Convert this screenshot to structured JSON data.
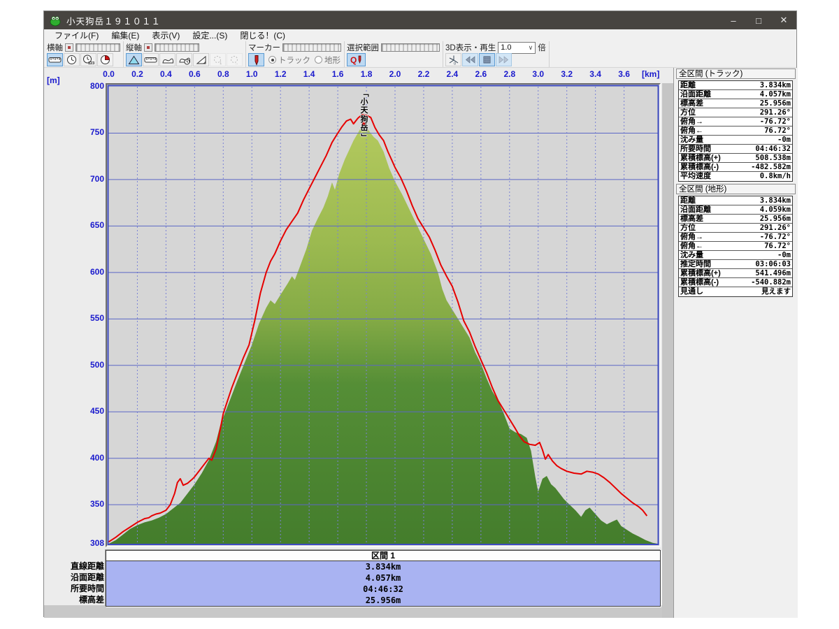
{
  "window": {
    "title": "小天狗岳１９１０１１",
    "controls": {
      "minimize": "–",
      "maximize": "□",
      "close": "✕"
    }
  },
  "menu": {
    "items": [
      {
        "label": "ファイル(F)"
      },
      {
        "label": "編集(E)"
      },
      {
        "label": "表示(V)"
      },
      {
        "label": "設定...(S)"
      },
      {
        "label": "閉じる！(C)"
      }
    ]
  },
  "toolbar": {
    "xaxis_label": "横軸",
    "yaxis_label": "縦軸",
    "marker_label": "マーカー",
    "selection_label": "選択範囲",
    "playback_label": "3D表示・再生",
    "playback_rate": "1.0",
    "playback_rate_suffix": "倍",
    "radio_track": "トラック",
    "radio_terrain": "地形"
  },
  "axis": {
    "y_unit": "[m]",
    "x_unit": "[km]"
  },
  "chart_data": {
    "type": "area",
    "title": "標高プロファイル (elevation profile)",
    "xlabel": "[km]",
    "ylabel": "[m]",
    "x_range": [
      0,
      3.834
    ],
    "y_range": [
      308,
      800
    ],
    "x_ticks": [
      0.0,
      0.2,
      0.4,
      0.6,
      0.8,
      1.0,
      1.2,
      1.4,
      1.6,
      1.8,
      2.0,
      2.2,
      2.4,
      2.6,
      2.8,
      3.0,
      3.2,
      3.4,
      3.6
    ],
    "y_ticks": [
      800,
      750,
      700,
      650,
      600,
      550,
      500,
      450,
      400,
      350,
      308
    ],
    "grid": true,
    "colors": {
      "plot_bg": "#d6d6d6",
      "grid_h": "#5b67c6",
      "grid_v": "#7a82d6",
      "frame": "#3c49c0",
      "tick_text": "#1a1acd",
      "track_line": "#e60000",
      "terrain_top": "#b3c95e",
      "terrain_mid": "#9cba50",
      "terrain_low": "#558e36",
      "terrain_bottom": "#447d2c"
    },
    "peak_annotation": {
      "text": "「小天狗岳」",
      "x_km": 1.785
    },
    "series": [
      {
        "name": "地形",
        "type": "area",
        "points": [
          [
            0,
            308
          ],
          [
            0.05,
            312
          ],
          [
            0.1,
            318
          ],
          [
            0.15,
            324
          ],
          [
            0.2,
            328
          ],
          [
            0.25,
            331
          ],
          [
            0.3,
            333
          ],
          [
            0.35,
            336
          ],
          [
            0.4,
            340
          ],
          [
            0.45,
            346
          ],
          [
            0.5,
            352
          ],
          [
            0.55,
            362
          ],
          [
            0.6,
            372
          ],
          [
            0.65,
            384
          ],
          [
            0.7,
            398
          ],
          [
            0.75,
            418
          ],
          [
            0.78,
            436
          ],
          [
            0.82,
            452
          ],
          [
            0.86,
            468
          ],
          [
            0.9,
            484
          ],
          [
            0.95,
            503
          ],
          [
            1.0,
            522
          ],
          [
            1.05,
            545
          ],
          [
            1.1,
            562
          ],
          [
            1.13,
            570
          ],
          [
            1.16,
            566
          ],
          [
            1.2,
            576
          ],
          [
            1.25,
            588
          ],
          [
            1.28,
            596
          ],
          [
            1.3,
            592
          ],
          [
            1.33,
            604
          ],
          [
            1.38,
            625
          ],
          [
            1.42,
            645
          ],
          [
            1.46,
            658
          ],
          [
            1.5,
            670
          ],
          [
            1.53,
            682
          ],
          [
            1.56,
            697
          ],
          [
            1.58,
            689
          ],
          [
            1.61,
            706
          ],
          [
            1.65,
            722
          ],
          [
            1.68,
            732
          ],
          [
            1.71,
            742
          ],
          [
            1.74,
            750
          ],
          [
            1.77,
            758
          ],
          [
            1.79,
            760
          ],
          [
            1.82,
            752
          ],
          [
            1.85,
            746
          ],
          [
            1.88,
            742
          ],
          [
            1.92,
            730
          ],
          [
            1.96,
            712
          ],
          [
            2.0,
            698
          ],
          [
            2.05,
            684
          ],
          [
            2.1,
            668
          ],
          [
            2.15,
            652
          ],
          [
            2.2,
            636
          ],
          [
            2.25,
            620
          ],
          [
            2.3,
            600
          ],
          [
            2.33,
            582
          ],
          [
            2.36,
            570
          ],
          [
            2.4,
            560
          ],
          [
            2.44,
            550
          ],
          [
            2.48,
            540
          ],
          [
            2.52,
            530
          ],
          [
            2.56,
            514
          ],
          [
            2.6,
            502
          ],
          [
            2.64,
            486
          ],
          [
            2.68,
            472
          ],
          [
            2.72,
            462
          ],
          [
            2.76,
            448
          ],
          [
            2.8,
            432
          ],
          [
            2.84,
            428
          ],
          [
            2.88,
            426
          ],
          [
            2.92,
            422
          ],
          [
            2.95,
            408
          ],
          [
            2.98,
            380
          ],
          [
            3.0,
            364
          ],
          [
            3.03,
            378
          ],
          [
            3.06,
            381
          ],
          [
            3.09,
            372
          ],
          [
            3.12,
            368
          ],
          [
            3.15,
            362
          ],
          [
            3.18,
            356
          ],
          [
            3.22,
            350
          ],
          [
            3.26,
            344
          ],
          [
            3.3,
            337
          ],
          [
            3.33,
            344
          ],
          [
            3.36,
            347
          ],
          [
            3.4,
            340
          ],
          [
            3.44,
            333
          ],
          [
            3.48,
            329
          ],
          [
            3.52,
            332
          ],
          [
            3.55,
            334
          ],
          [
            3.58,
            327
          ],
          [
            3.62,
            323
          ],
          [
            3.66,
            319
          ],
          [
            3.7,
            316
          ],
          [
            3.75,
            312
          ],
          [
            3.8,
            309
          ],
          [
            3.834,
            308
          ]
        ]
      },
      {
        "name": "トラック",
        "type": "line",
        "points": [
          [
            0,
            310
          ],
          [
            0.05,
            315
          ],
          [
            0.1,
            321
          ],
          [
            0.15,
            326
          ],
          [
            0.2,
            331
          ],
          [
            0.25,
            335
          ],
          [
            0.28,
            336
          ],
          [
            0.3,
            338
          ],
          [
            0.33,
            340
          ],
          [
            0.36,
            341
          ],
          [
            0.4,
            344
          ],
          [
            0.43,
            350
          ],
          [
            0.46,
            362
          ],
          [
            0.48,
            374
          ],
          [
            0.5,
            378
          ],
          [
            0.52,
            371
          ],
          [
            0.55,
            373
          ],
          [
            0.58,
            377
          ],
          [
            0.6,
            380
          ],
          [
            0.63,
            386
          ],
          [
            0.66,
            392
          ],
          [
            0.7,
            400
          ],
          [
            0.72,
            398
          ],
          [
            0.75,
            410
          ],
          [
            0.78,
            432
          ],
          [
            0.8,
            448
          ],
          [
            0.83,
            462
          ],
          [
            0.86,
            476
          ],
          [
            0.9,
            492
          ],
          [
            0.94,
            508
          ],
          [
            0.98,
            522
          ],
          [
            1.02,
            548
          ],
          [
            1.06,
            578
          ],
          [
            1.1,
            600
          ],
          [
            1.13,
            612
          ],
          [
            1.16,
            620
          ],
          [
            1.2,
            634
          ],
          [
            1.24,
            646
          ],
          [
            1.28,
            655
          ],
          [
            1.32,
            664
          ],
          [
            1.36,
            678
          ],
          [
            1.4,
            690
          ],
          [
            1.44,
            702
          ],
          [
            1.48,
            714
          ],
          [
            1.52,
            726
          ],
          [
            1.56,
            740
          ],
          [
            1.6,
            750
          ],
          [
            1.63,
            757
          ],
          [
            1.66,
            763
          ],
          [
            1.69,
            765
          ],
          [
            1.71,
            760
          ],
          [
            1.74,
            766
          ],
          [
            1.77,
            770
          ],
          [
            1.8,
            769
          ],
          [
            1.83,
            767
          ],
          [
            1.86,
            756
          ],
          [
            1.89,
            748
          ],
          [
            1.92,
            742
          ],
          [
            1.95,
            730
          ],
          [
            1.98,
            720
          ],
          [
            2.0,
            713
          ],
          [
            2.04,
            702
          ],
          [
            2.08,
            688
          ],
          [
            2.12,
            672
          ],
          [
            2.16,
            658
          ],
          [
            2.2,
            648
          ],
          [
            2.24,
            638
          ],
          [
            2.28,
            624
          ],
          [
            2.32,
            608
          ],
          [
            2.36,
            596
          ],
          [
            2.4,
            585
          ],
          [
            2.44,
            568
          ],
          [
            2.48,
            548
          ],
          [
            2.52,
            536
          ],
          [
            2.56,
            520
          ],
          [
            2.6,
            506
          ],
          [
            2.64,
            492
          ],
          [
            2.68,
            476
          ],
          [
            2.72,
            462
          ],
          [
            2.76,
            452
          ],
          [
            2.8,
            442
          ],
          [
            2.84,
            432
          ],
          [
            2.87,
            424
          ],
          [
            2.9,
            418
          ],
          [
            2.94,
            415
          ],
          [
            2.98,
            414
          ],
          [
            3.01,
            417
          ],
          [
            3.03,
            409
          ],
          [
            3.05,
            399
          ],
          [
            3.07,
            404
          ],
          [
            3.1,
            397
          ],
          [
            3.13,
            392
          ],
          [
            3.16,
            389
          ],
          [
            3.2,
            386
          ],
          [
            3.25,
            384
          ],
          [
            3.3,
            383
          ],
          [
            3.34,
            386
          ],
          [
            3.38,
            385
          ],
          [
            3.42,
            383
          ],
          [
            3.46,
            379
          ],
          [
            3.5,
            374
          ],
          [
            3.54,
            368
          ],
          [
            3.58,
            362
          ],
          [
            3.62,
            357
          ],
          [
            3.66,
            352
          ],
          [
            3.7,
            348
          ],
          [
            3.73,
            344
          ],
          [
            3.76,
            338
          ]
        ]
      }
    ]
  },
  "track_panel": {
    "title": "全区間 (トラック)",
    "rows": [
      {
        "label": "距離",
        "value": "3.834km"
      },
      {
        "label": "沿面距離",
        "value": "4.057km"
      },
      {
        "label": "標高差",
        "value": "25.956m"
      },
      {
        "label": "方位",
        "value": "291.26°"
      },
      {
        "label": "俯角→",
        "value": "-76.72°"
      },
      {
        "label": "俯角←",
        "value": "76.72°"
      },
      {
        "label": "沈み量",
        "value": "-0m"
      },
      {
        "label": "所要時間",
        "value": "04:46:32"
      },
      {
        "label": "累積標高(+)",
        "value": "508.538m"
      },
      {
        "label": "累積標高(-)",
        "value": "-482.582m"
      },
      {
        "label": "平均速度",
        "value": "0.8km/h"
      }
    ]
  },
  "terrain_panel": {
    "title": "全区間 (地形)",
    "rows": [
      {
        "label": "距離",
        "value": "3.834km"
      },
      {
        "label": "沿面距離",
        "value": "4.059km"
      },
      {
        "label": "標高差",
        "value": "25.956m"
      },
      {
        "label": "方位",
        "value": "291.26°"
      },
      {
        "label": "俯角→",
        "value": "-76.72°"
      },
      {
        "label": "俯角←",
        "value": "76.72°"
      },
      {
        "label": "沈み量",
        "value": "-0m"
      },
      {
        "label": "推定時間",
        "value": "03:06:03"
      },
      {
        "label": "累積標高(+)",
        "value": "541.496m"
      },
      {
        "label": "累積標高(-)",
        "value": "-540.882m"
      },
      {
        "label": "見通し",
        "value": "見えます"
      }
    ]
  },
  "segment_table": {
    "header": "区間 1",
    "rows": [
      {
        "label": "直線距離",
        "value": "3.834km"
      },
      {
        "label": "沿面距離",
        "value": "4.057km"
      },
      {
        "label": "所要時間",
        "value": "04:46:32"
      },
      {
        "label": "標高差",
        "value": "25.956m"
      }
    ]
  }
}
